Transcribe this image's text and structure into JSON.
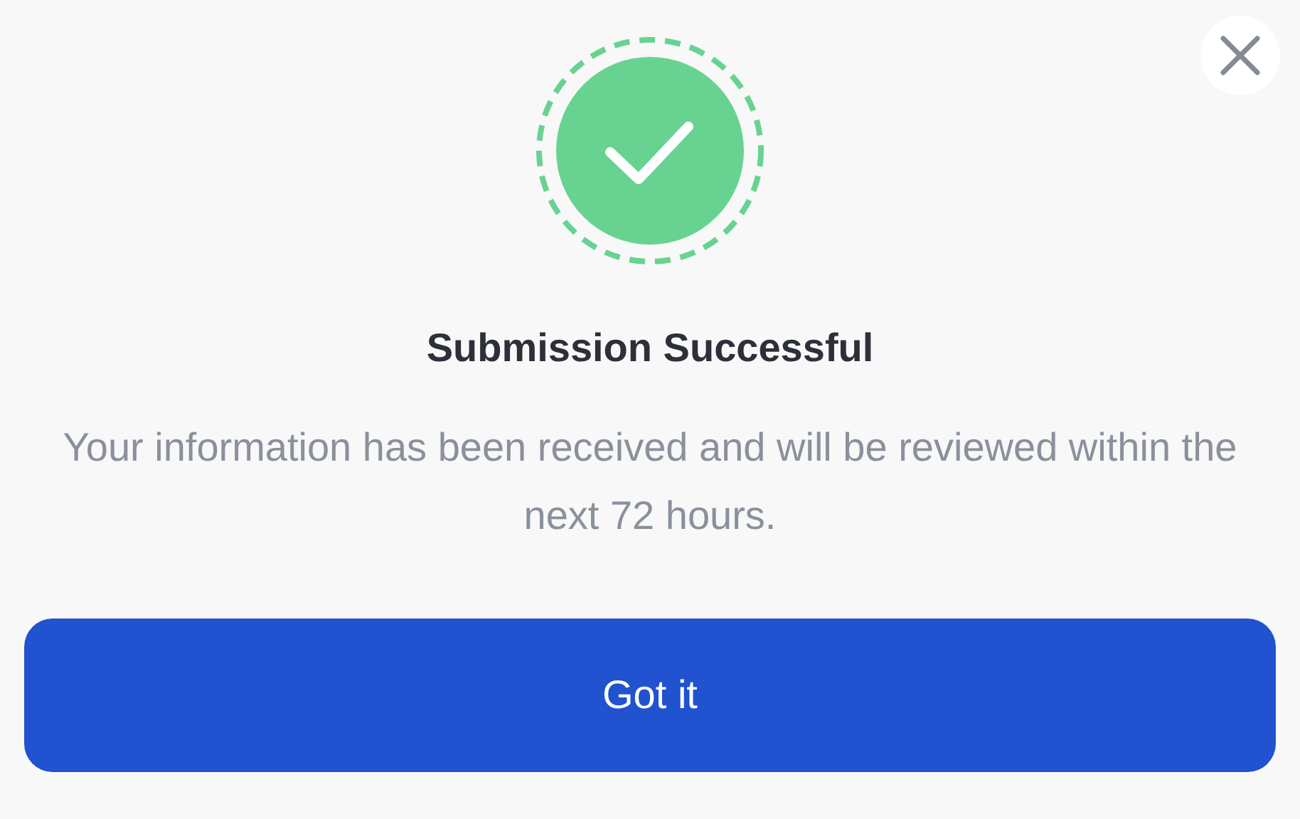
{
  "dialog": {
    "title": "Submission Successful",
    "message": "Your information has been received and will be reviewed within the next 72 hours.",
    "button": "Got it"
  }
}
